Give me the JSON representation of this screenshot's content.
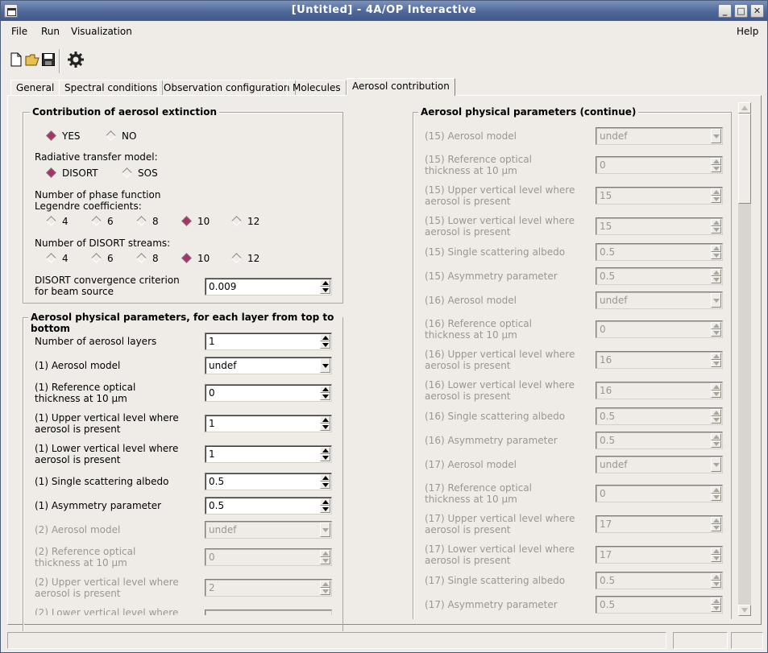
{
  "window": {
    "title": "[Untitled] - 4A/OP Interactive"
  },
  "menu": {
    "file": "File",
    "run": "Run",
    "visualization": "Visualization",
    "help": "Help"
  },
  "toolbar": {
    "new": "new-file-icon",
    "open": "open-folder-icon",
    "save": "save-icon",
    "run": "gear-icon"
  },
  "tabs": [
    "General",
    "Spectral conditions",
    "Observation configuration",
    "Molecules",
    "Aerosol contribution"
  ],
  "left": {
    "extinction": {
      "title": "Contribution of aerosol extinction",
      "yes": "YES",
      "no": "NO",
      "selected": "YES",
      "rtm_label": "Radiative transfer model:",
      "disort": "DISORT",
      "sos": "SOS",
      "rtm_selected": "DISORT",
      "legendre_label": "Number of phase function Legendre coefficients:",
      "legendre_options": [
        "4",
        "6",
        "8",
        "10",
        "12"
      ],
      "legendre_selected": "10",
      "streams_label": "Number of DISORT streams:",
      "streams_options": [
        "4",
        "6",
        "8",
        "10",
        "12"
      ],
      "streams_selected": "10",
      "conv_label": "DISORT convergence criterion for beam source",
      "conv_value": "0.009"
    },
    "physical": {
      "title": "Aerosol physical parameters, for each layer from top to bottom",
      "n_layers_label": "Number of aerosol layers",
      "n_layers_value": "1",
      "l1_model_label": "(1) Aerosol model",
      "l1_model_value": "undef",
      "l1_thick_label": "(1) Reference optical thickness at 10 μm",
      "l1_thick_value": "0",
      "l1_upper_label": "(1) Upper vertical level where aerosol is present",
      "l1_upper_value": "1",
      "l1_lower_label": "(1) Lower vertical level where aerosol is present",
      "l1_lower_value": "1",
      "l1_albedo_label": "(1) Single scattering albedo",
      "l1_albedo_value": "0.5",
      "l1_asym_label": "(1) Asymmetry parameter",
      "l1_asym_value": "0.5",
      "l2_model_label": "(2) Aerosol model",
      "l2_model_value": "undef",
      "l2_thick_label": "(2) Reference optical thickness at 10 μm",
      "l2_thick_value": "0",
      "l2_upper_label": "(2) Upper vertical level where aerosol is present",
      "l2_upper_value": "2",
      "l2_lower_label": "(2) Lower vertical level where"
    }
  },
  "right": {
    "title": "Aerosol physical parameters (continue)",
    "rows": [
      {
        "label": "(15) Aerosol model",
        "value": "undef",
        "kind": "combo"
      },
      {
        "label": "(15) Reference optical thickness at 10 μm",
        "value": "0",
        "kind": "spin"
      },
      {
        "label": "(15) Upper vertical level where aerosol is present",
        "value": "15",
        "kind": "spin"
      },
      {
        "label": "(15) Lower vertical level where aerosol is present",
        "value": "15",
        "kind": "spin"
      },
      {
        "label": "(15) Single scattering albedo",
        "value": "0.5",
        "kind": "spin"
      },
      {
        "label": "(15) Asymmetry parameter",
        "value": "0.5",
        "kind": "spin"
      },
      {
        "label": "(16) Aerosol model",
        "value": "undef",
        "kind": "combo"
      },
      {
        "label": "(16) Reference optical thickness at 10 μm",
        "value": "0",
        "kind": "spin"
      },
      {
        "label": "(16) Upper vertical level where aerosol is present",
        "value": "16",
        "kind": "spin"
      },
      {
        "label": "(16) Lower vertical level where aerosol is present",
        "value": "16",
        "kind": "spin"
      },
      {
        "label": "(16) Single scattering albedo",
        "value": "0.5",
        "kind": "spin"
      },
      {
        "label": "(16) Asymmetry parameter",
        "value": "0.5",
        "kind": "spin"
      },
      {
        "label": "(17) Aerosol model",
        "value": "undef",
        "kind": "combo"
      },
      {
        "label": "(17) Reference optical thickness at 10 μm",
        "value": "0",
        "kind": "spin"
      },
      {
        "label": "(17) Upper vertical level where aerosol is present",
        "value": "17",
        "kind": "spin"
      },
      {
        "label": "(17) Lower vertical level where aerosol is present",
        "value": "17",
        "kind": "spin"
      },
      {
        "label": "(17) Single scattering albedo",
        "value": "0.5",
        "kind": "spin"
      },
      {
        "label": "(17) Asymmetry parameter",
        "value": "0.5",
        "kind": "spin"
      }
    ]
  },
  "colors": {
    "titlebar": "#4d6798",
    "radio_selected": "#b03060",
    "background": "#efebe7"
  }
}
